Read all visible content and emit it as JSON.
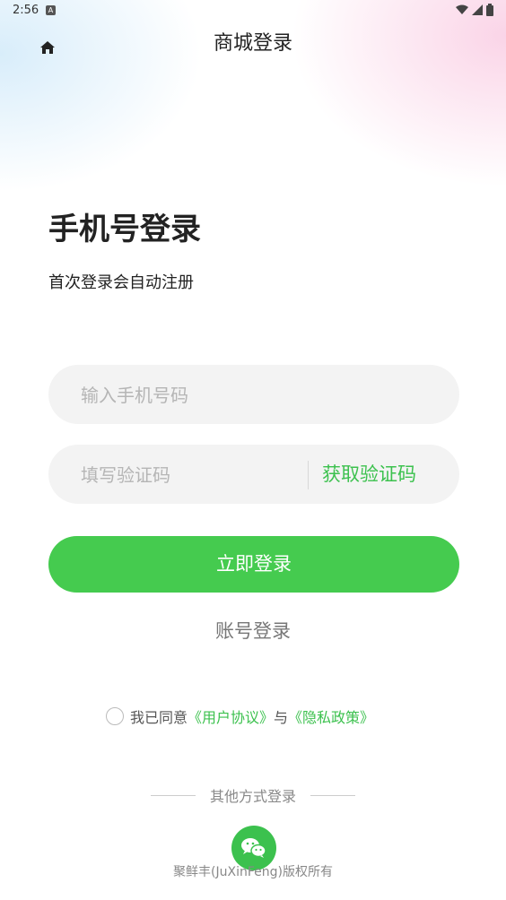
{
  "status_bar": {
    "time": "2:56",
    "notif_icon": "a-icon",
    "signal": "wifi-icon",
    "battery": "battery-icon"
  },
  "nav": {
    "home_icon": "home-icon",
    "title": "商城登录"
  },
  "headline": "手机号登录",
  "subline": "首次登录会自动注册",
  "phone_field": {
    "placeholder": "输入手机号码",
    "value": ""
  },
  "code_field": {
    "placeholder": "填写验证码",
    "value": "",
    "get_code_label": "获取验证码"
  },
  "login_button": "立即登录",
  "account_login": "账号登录",
  "agreement": {
    "prefix": "我已同意",
    "user_agreement": "《用户协议》",
    "joiner": "与",
    "privacy_policy": "《隐私政策》",
    "checked": false
  },
  "other_login": {
    "label": "其他方式登录",
    "wechat_icon": "wechat-icon"
  },
  "copyright": "聚鲜丰(JuXinFeng)版权所有",
  "colors": {
    "accent": "#45cb4f",
    "link": "#3cc14e"
  }
}
